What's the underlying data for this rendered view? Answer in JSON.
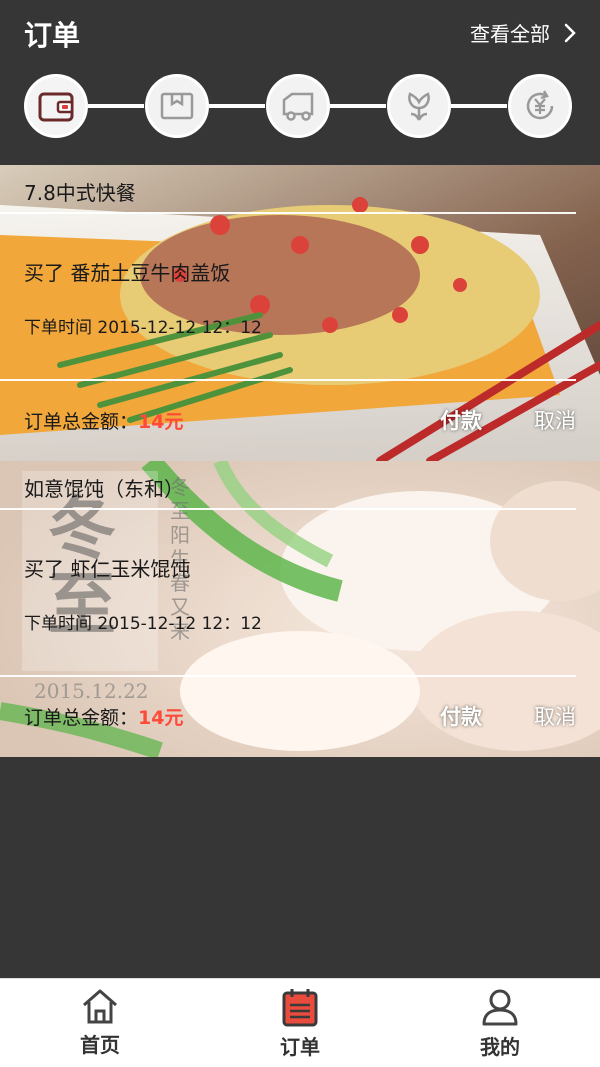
{
  "header": {
    "title": "订单",
    "view_all": "查看全部"
  },
  "steps": [
    {
      "icon": "wallet-icon",
      "active": true
    },
    {
      "icon": "package-icon",
      "active": false
    },
    {
      "icon": "delivery-truck-icon",
      "active": false
    },
    {
      "icon": "flower-icon",
      "active": false
    },
    {
      "icon": "refund-yen-icon",
      "active": false
    }
  ],
  "orders": [
    {
      "shop": "7.8中式快餐",
      "item": "买了 番茄土豆牛肉盖饭",
      "time": "下单时间 2015-12-12 12：12",
      "total_label": "订单总金额：",
      "total_amount": "14元",
      "pay": "付款",
      "cancel": "取消"
    },
    {
      "shop": "如意馄饨（东和）",
      "item": "买了 虾仁玉米馄饨",
      "time": "下单时间 2015-12-12 12：12",
      "total_label": "订单总金额：",
      "total_amount": "14元",
      "pay": "付款",
      "cancel": "取消",
      "image_text": {
        "big": "冬至",
        "vertical": "冬至阳生春又来",
        "date": "2015.12.22"
      }
    }
  ],
  "tabbar": {
    "items": [
      {
        "label": "首页",
        "icon": "home-icon",
        "active": false
      },
      {
        "label": "订单",
        "icon": "calendar-order-icon",
        "active": true
      },
      {
        "label": "我的",
        "icon": "user-icon",
        "active": false
      }
    ]
  },
  "colors": {
    "background": "#363636",
    "accent_red": "#ff4a3a",
    "active_tab": "#e94b3c"
  }
}
